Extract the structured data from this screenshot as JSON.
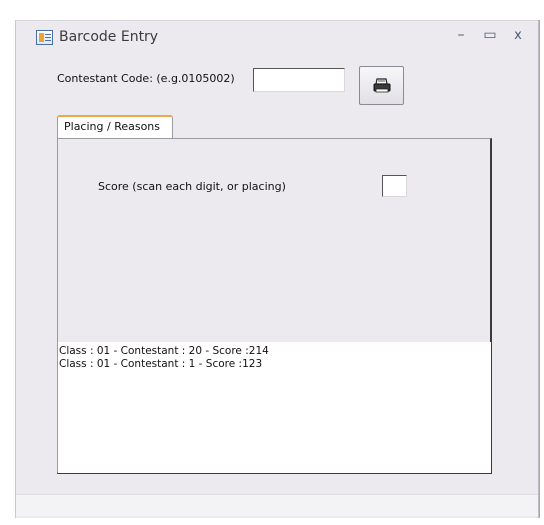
{
  "window": {
    "title": "Barcode Entry",
    "controls": {
      "minimize": "–",
      "maximize": "▭",
      "close": "x"
    }
  },
  "form": {
    "contestant_code_label": "Contestant Code: (e.g.0105002)",
    "contestant_code_value": "",
    "print_icon": "printer-icon"
  },
  "tabs": [
    {
      "label": "Placing / Reasons",
      "selected": true
    }
  ],
  "panel": {
    "score_label": "Score (scan each digit, or placing)",
    "score_value": ""
  },
  "results": [
    "Class : 01 - Contestant : 20 - Score :214",
    "Class : 01 - Contestant : 1 - Score :123"
  ],
  "colors": {
    "window_bg": "#eceaee",
    "tab_accent": "#f2a64a",
    "list_bg": "#ffffff"
  }
}
